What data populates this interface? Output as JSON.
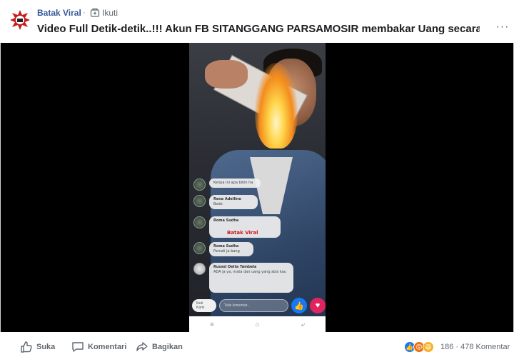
{
  "header": {
    "page_name": "Batak Viral",
    "separator": "·",
    "follow_label": "Ikuti",
    "title": "Video Full Detik-detik..!!! Akun FB SITANGGANG PARSAMOSIR membakar Uang secara…",
    "more_label": "···"
  },
  "video": {
    "watermark": "Batak Viral",
    "comments": [
      {
        "name": "",
        "text": "Kenpa ini apa bikin ha"
      },
      {
        "name": "Rena Adelline",
        "text": "Bodo"
      },
      {
        "name": "Roma Sudha",
        "text": ""
      },
      {
        "name": "Roma Sudha",
        "text": "Pamali ja bang"
      },
      {
        "name": "Russel Delta Tambela",
        "text": "ADA ja ya, mata dan uang yang abis kau"
      }
    ],
    "live_pill": "Ikuti Kami",
    "comment_placeholder": "Tulis komentar...",
    "like_icon": "👍",
    "love_icon": "♥",
    "nav_icons": [
      "≡",
      "⌂",
      "⤶"
    ]
  },
  "footer": {
    "like_label": "Suka",
    "comment_label": "Komentari",
    "share_label": "Bagikan",
    "reaction_count": "186",
    "stats_separator": " · ",
    "comment_count": "478 Komentar"
  },
  "colors": {
    "link_blue": "#385898",
    "fb_blue": "#1877f2",
    "gray_text": "#606770"
  }
}
